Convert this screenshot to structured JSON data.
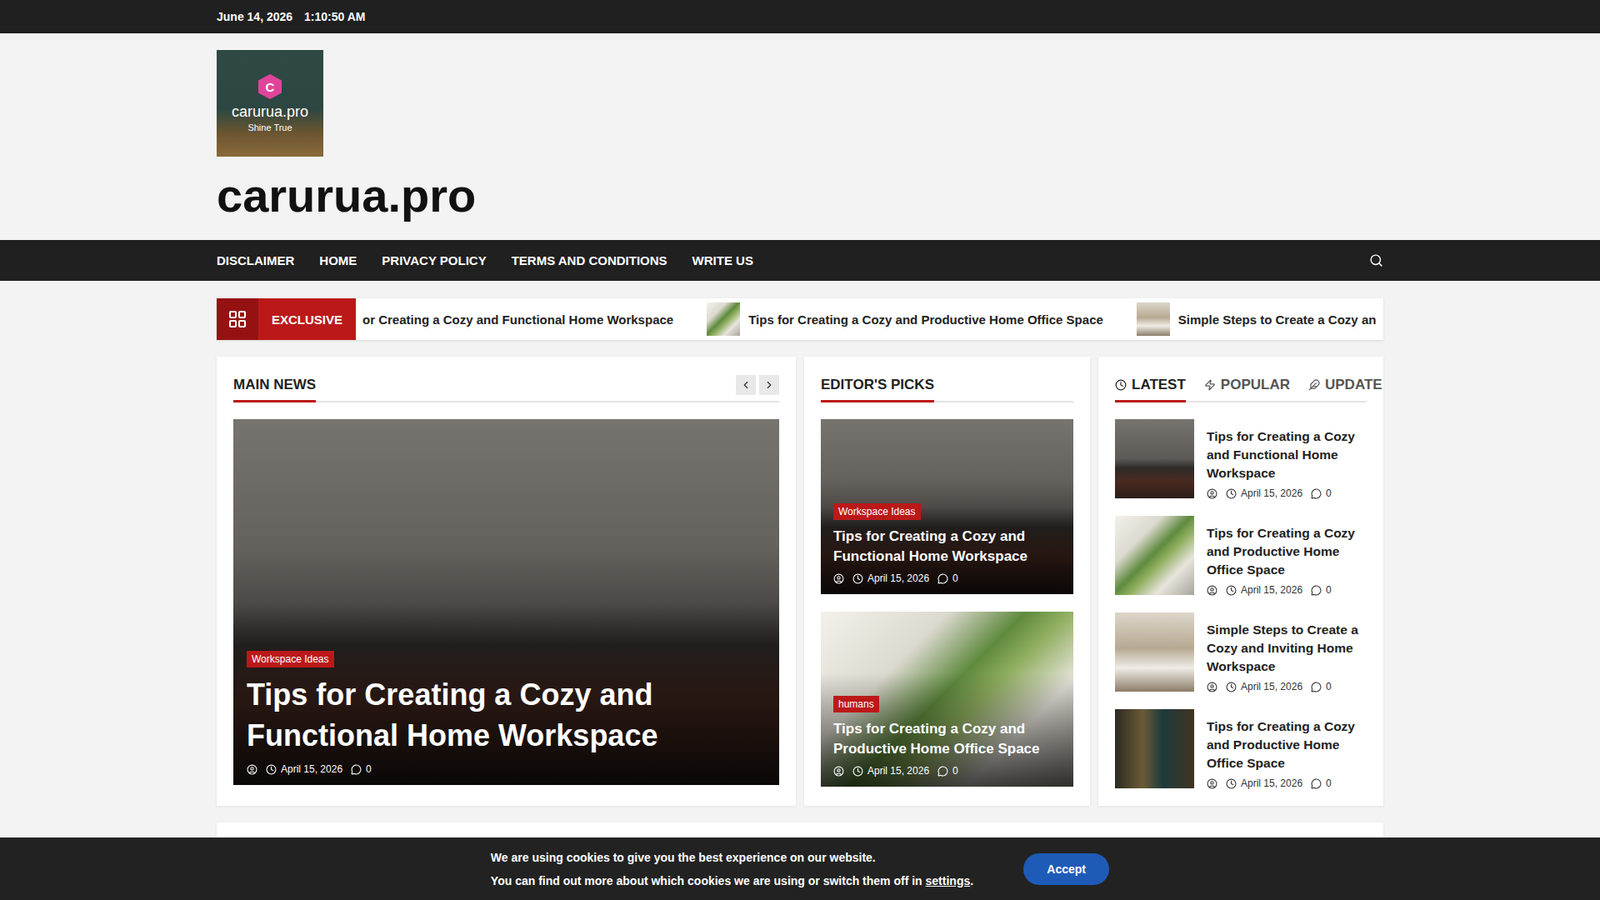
{
  "topbar": {
    "date": "June 14, 2026",
    "time": "1:10:50 AM"
  },
  "site": {
    "logo_letter": "C",
    "logo_name": "carurua.pro",
    "logo_tagline": "Shine True",
    "title": "carurua.pro"
  },
  "nav": {
    "items": [
      {
        "label": "DISCLAIMER"
      },
      {
        "label": "HOME"
      },
      {
        "label": "PRIVACY POLICY"
      },
      {
        "label": "TERMS AND CONDITIONS"
      },
      {
        "label": "WRITE US"
      }
    ]
  },
  "ticker": {
    "label": "EXCLUSIVE",
    "items": [
      {
        "title": "or Creating a Cozy and Functional Home Workspace",
        "thumb": false
      },
      {
        "title": "Tips for Creating a Cozy and Productive Home Office Space",
        "thumb": true
      },
      {
        "title": "Simple Steps to Create a Cozy an",
        "thumb": true
      }
    ]
  },
  "main_news": {
    "heading": "MAIN NEWS",
    "slide": {
      "category": "Workspace Ideas",
      "title": "Tips for Creating a Cozy and Functional Home Workspace",
      "date": "April 15, 2026",
      "comments": "0"
    }
  },
  "editors_picks": {
    "heading": "EDITOR'S PICKS",
    "items": [
      {
        "category": "Workspace Ideas",
        "title": "Tips for Creating a Cozy and Functional Home Workspace",
        "date": "April 15, 2026",
        "comments": "0"
      },
      {
        "category": "humans",
        "title": "Tips for Creating a Cozy and Productive Home Office Space",
        "date": "April 15, 2026",
        "comments": "0"
      }
    ]
  },
  "sidebar": {
    "tabs": [
      {
        "label": "LATEST",
        "selected": true
      },
      {
        "label": "POPULAR",
        "selected": false
      },
      {
        "label": "UPDATE",
        "selected": false
      }
    ],
    "items": [
      {
        "title": "Tips for Creating a Cozy and Functional Home Workspace",
        "date": "April 15, 2026",
        "comments": "0"
      },
      {
        "title": "Tips for Creating a Cozy and Productive Home Office Space",
        "date": "April 15, 2026",
        "comments": "0"
      },
      {
        "title": "Simple Steps to Create a Cozy and Inviting Home Workspace",
        "date": "April 15, 2026",
        "comments": "0"
      },
      {
        "title": "Tips for Creating a Cozy and Productive Home Office Space",
        "date": "April 15, 2026",
        "comments": "0"
      }
    ]
  },
  "cookie": {
    "line1": "We are using cookies to give you the best experience on our website.",
    "line2": "You can find out more about which cookies we are using or switch them off in",
    "link": "settings",
    "end": ".",
    "button": "Accept"
  }
}
